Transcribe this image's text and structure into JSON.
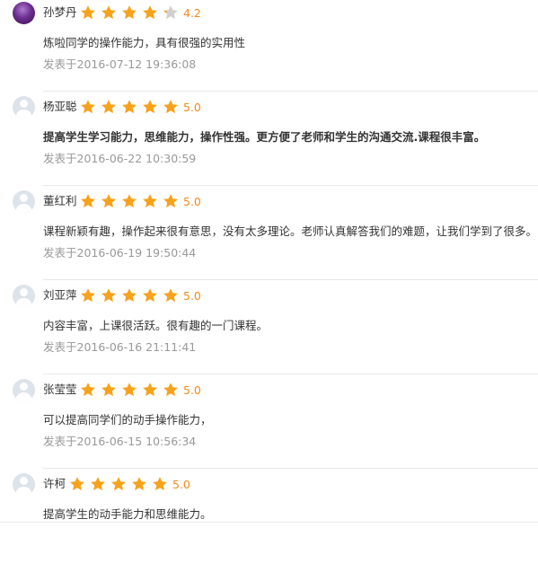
{
  "colors": {
    "star_fill": "#f7a21b",
    "star_empty": "#cfcfcf",
    "rating_text": "#f28b20",
    "time_text": "#999999",
    "separator": "#e8e8e8"
  },
  "reviews": [
    {
      "name": "孙梦丹",
      "avatar": "photo",
      "stars": 4.2,
      "rating": "4.2",
      "content": "炼啦同学的操作能力，具有很强的实用性",
      "bold": false,
      "time": "发表于2016-07-12 19:36:08"
    },
    {
      "name": "杨亚聪",
      "avatar": "default",
      "stars": 5,
      "rating": "5.0",
      "content": "提高学生学习能力，思维能力，操作性强。更方便了老师和学生的沟通交流.课程很丰富。",
      "bold": true,
      "time": "发表于2016-06-22 10:30:59"
    },
    {
      "name": "董红利",
      "avatar": "default",
      "stars": 5,
      "rating": "5.0",
      "content": "课程新颖有趣，操作起来很有意思，没有太多理论。老师认真解答我们的难题，让我们学到了很多。",
      "bold": false,
      "time": "发表于2016-06-19 19:50:44"
    },
    {
      "name": "刘亚萍",
      "avatar": "default",
      "stars": 5,
      "rating": "5.0",
      "content": "内容丰富，上课很活跃。很有趣的一门课程。",
      "bold": false,
      "time": "发表于2016-06-16 21:11:41"
    },
    {
      "name": "张莹莹",
      "avatar": "default",
      "stars": 5,
      "rating": "5.0",
      "content": "可以提高同学们的动手操作能力，",
      "bold": false,
      "time": "发表于2016-06-15 10:56:34"
    },
    {
      "name": "许柯",
      "avatar": "default",
      "stars": 5,
      "rating": "5.0",
      "content": "提高学生的动手能力和思维能力。",
      "bold": false,
      "time": ""
    }
  ]
}
